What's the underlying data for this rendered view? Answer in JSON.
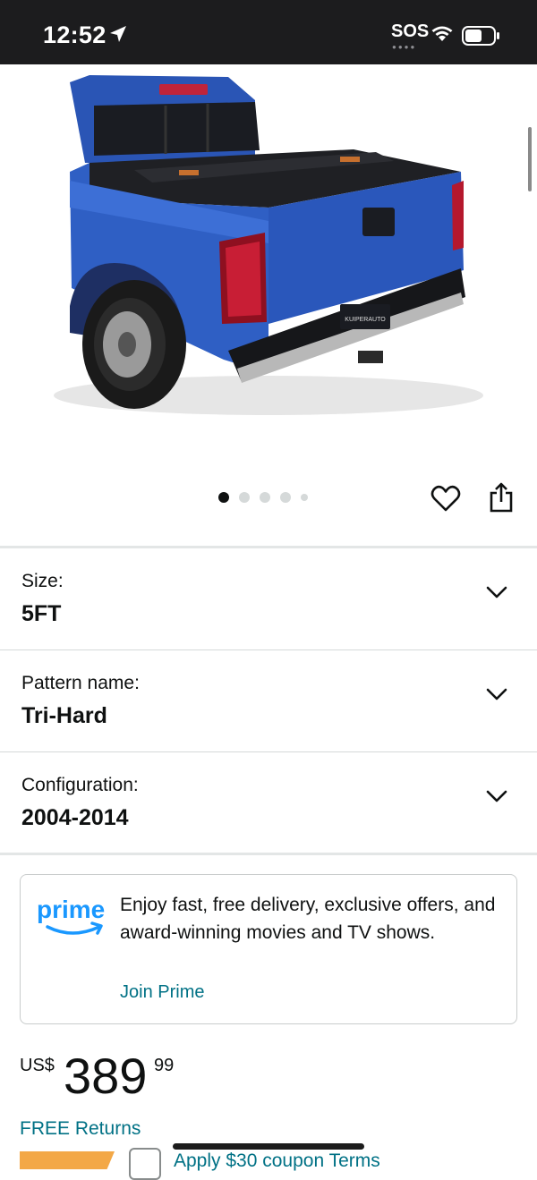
{
  "status_bar": {
    "time": "12:52",
    "sos": "SOS",
    "location_icon": "location-arrow-icon",
    "wifi_icon": "wifi-icon",
    "battery_icon": "battery-icon"
  },
  "product_image": {
    "subject": "truck-bed-tonneau-cover-photo",
    "plate_text": "KUIPERAUTO",
    "truck_color": "#2f5fc4"
  },
  "carousel": {
    "total_images": 5,
    "active_index": 0
  },
  "actions": {
    "favorite_icon": "heart-icon",
    "share_icon": "share-icon"
  },
  "variations": [
    {
      "label": "Size:",
      "value": "5FT"
    },
    {
      "label": "Pattern name:",
      "value": "Tri-Hard"
    },
    {
      "label": "Configuration:",
      "value": "2004-2014"
    }
  ],
  "prime_banner": {
    "logo_text": "prime",
    "message": "Enjoy fast, free delivery, exclusive offers, and award-winning movies and TV shows.",
    "link_label": "Join Prime"
  },
  "price": {
    "currency": "US$",
    "whole": "389",
    "fraction": "99"
  },
  "returns_label": "FREE Returns",
  "coupon": {
    "text": "Apply $30 coupon   Terms"
  },
  "colors": {
    "link": "#007185",
    "prime_blue": "#1a98ff",
    "coupon_orange": "#f3a847",
    "text": "#0f1111"
  }
}
